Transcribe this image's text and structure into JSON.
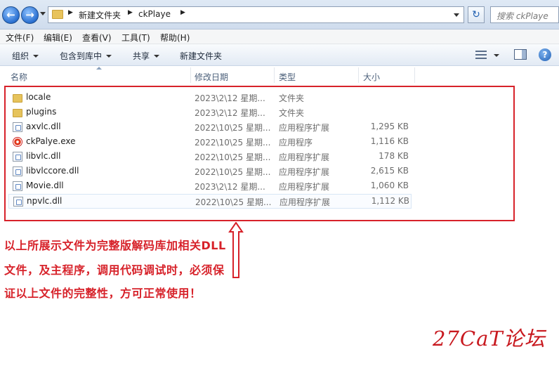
{
  "address_bar": {
    "breadcrumbs": [
      "新建文件夹",
      "ckPlaye"
    ],
    "search_placeholder": "搜索 ckPlaye"
  },
  "menu": [
    "文件(F)",
    "编辑(E)",
    "查看(V)",
    "工具(T)",
    "帮助(H)"
  ],
  "toolbar": {
    "organize": "组织",
    "include_in_library": "包含到库中",
    "share": "共享",
    "new_folder": "新建文件夹"
  },
  "columns": [
    "名称",
    "修改日期",
    "类型",
    "大小"
  ],
  "files": [
    {
      "name": "locale",
      "date": "2023\\2\\12 星期...",
      "type": "文件夹",
      "size": "",
      "icon": "folder-icon"
    },
    {
      "name": "plugins",
      "date": "2023\\2\\12 星期...",
      "type": "文件夹",
      "size": "",
      "icon": "folder-icon"
    },
    {
      "name": "axvlc.dll",
      "date": "2022\\10\\25 星期...",
      "type": "应用程序扩展",
      "size": "1,295 KB",
      "icon": "dll-icon"
    },
    {
      "name": "ckPalye.exe",
      "date": "2022\\10\\25 星期...",
      "type": "应用程序",
      "size": "1,116 KB",
      "icon": "exe-icon"
    },
    {
      "name": "libvlc.dll",
      "date": "2022\\10\\25 星期...",
      "type": "应用程序扩展",
      "size": "178 KB",
      "icon": "dll-icon"
    },
    {
      "name": "libvlccore.dll",
      "date": "2022\\10\\25 星期...",
      "type": "应用程序扩展",
      "size": "2,615 KB",
      "icon": "dll-icon"
    },
    {
      "name": "Movie.dll",
      "date": "2023\\2\\12 星期...",
      "type": "应用程序扩展",
      "size": "1,060 KB",
      "icon": "dll-icon"
    },
    {
      "name": "npvlc.dll",
      "date": "2022\\10\\25 星期...",
      "type": "应用程序扩展",
      "size": "1,112 KB",
      "icon": "dll-icon"
    }
  ],
  "annotation": {
    "lines": [
      "以上所展示文件为完整版解码库加相关DLL",
      "文件，及主程序，调用代码调试时，必须保",
      "证以上文件的完整性，方可正常使用！"
    ],
    "color": "#d7222a"
  },
  "watermark": "27CaT论坛"
}
